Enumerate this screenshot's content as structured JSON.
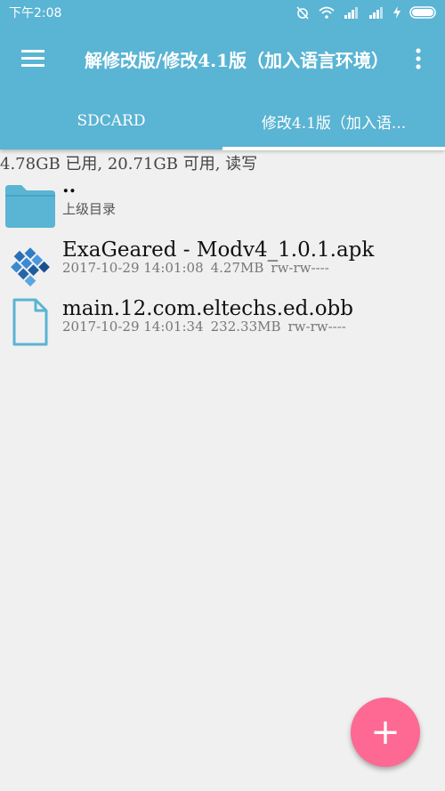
{
  "status_bar": {
    "time": "下午2:08"
  },
  "toolbar": {
    "title": "解修改版/修改4.1版（加入语言环境）",
    "menu_icon": "hamburger-menu-icon",
    "more_icon": "more-vert-icon"
  },
  "tabs": [
    {
      "label": "SDCARD",
      "selected": false
    },
    {
      "label": "修改4.1版（加入语...",
      "selected": true
    }
  ],
  "storage_info": "4.78GB 已用, 20.71GB 可用, 读写",
  "files": [
    {
      "name": "..",
      "subtitle": "上级目录",
      "icon": "folder-icon"
    },
    {
      "name": "ExaGeared - Modv4_1.0.1.apk",
      "date": "2017-10-29 14:01:08",
      "size": "4.27MB",
      "perms": "rw-rw----",
      "icon": "apk-app-icon"
    },
    {
      "name": "main.12.com.eltechs.ed.obb",
      "date": "2017-10-29 14:01:34",
      "size": "232.33MB",
      "perms": "rw-rw----",
      "icon": "file-icon"
    }
  ],
  "fab": {
    "label": "+",
    "icon": "add-icon"
  },
  "colors": {
    "appbar": "#5ab4d3",
    "background": "#f0f0f0",
    "fab": "#fd6993",
    "folder": "#5ab4d3"
  }
}
